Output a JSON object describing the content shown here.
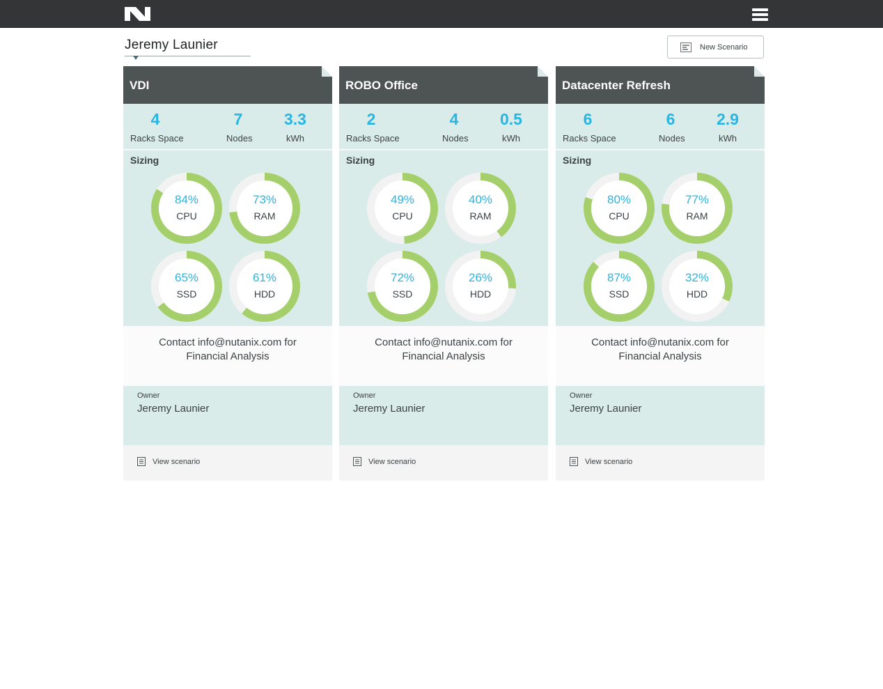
{
  "header": {
    "logo_icon": "nutanix-logo-icon",
    "menu_icon": "hamburger-menu-icon"
  },
  "toolbar": {
    "user_name": "Jeremy Launier",
    "new_scenario_label": "New Scenario",
    "new_scenario_icon": "scenario-form-icon"
  },
  "colors": {
    "accent_blue": "#27b5e3",
    "gauge_green": "#a5cf6a",
    "panel_teal": "#d9ecea",
    "header_dark": "#4e5354",
    "topbar": "#333537"
  },
  "cards": [
    {
      "title": "VDI",
      "stats": [
        {
          "value": "4",
          "label": "Racks Space"
        },
        {
          "value": "7",
          "label": "Nodes"
        },
        {
          "value": "3.3",
          "label": "kWh"
        }
      ],
      "sizing_title": "Sizing",
      "gauges": [
        {
          "percent": 84,
          "percent_text": "84%",
          "label": "CPU"
        },
        {
          "percent": 73,
          "percent_text": "73%",
          "label": "RAM"
        },
        {
          "percent": 65,
          "percent_text": "65%",
          "label": "SSD"
        },
        {
          "percent": 61,
          "percent_text": "61%",
          "label": "HDD"
        }
      ],
      "contact_text": "Contact info@nutanix.com for Financial Analysis",
      "owner_label": "Owner",
      "owner_name": "Jeremy Launier",
      "view_label": "View scenario"
    },
    {
      "title": "ROBO Office",
      "stats": [
        {
          "value": "2",
          "label": "Racks Space"
        },
        {
          "value": "4",
          "label": "Nodes"
        },
        {
          "value": "0.5",
          "label": "kWh"
        }
      ],
      "sizing_title": "Sizing",
      "gauges": [
        {
          "percent": 49,
          "percent_text": "49%",
          "label": "CPU"
        },
        {
          "percent": 40,
          "percent_text": "40%",
          "label": "RAM"
        },
        {
          "percent": 72,
          "percent_text": "72%",
          "label": "SSD"
        },
        {
          "percent": 26,
          "percent_text": "26%",
          "label": "HDD"
        }
      ],
      "contact_text": "Contact info@nutanix.com for Financial Analysis",
      "owner_label": "Owner",
      "owner_name": "Jeremy Launier",
      "view_label": "View scenario"
    },
    {
      "title": "Datacenter Refresh",
      "stats": [
        {
          "value": "6",
          "label": "Racks Space"
        },
        {
          "value": "6",
          "label": "Nodes"
        },
        {
          "value": "2.9",
          "label": "kWh"
        }
      ],
      "sizing_title": "Sizing",
      "gauges": [
        {
          "percent": 80,
          "percent_text": "80%",
          "label": "CPU"
        },
        {
          "percent": 77,
          "percent_text": "77%",
          "label": "RAM"
        },
        {
          "percent": 87,
          "percent_text": "87%",
          "label": "SSD"
        },
        {
          "percent": 32,
          "percent_text": "32%",
          "label": "HDD"
        }
      ],
      "contact_text": "Contact info@nutanix.com for Financial Analysis",
      "owner_label": "Owner",
      "owner_name": "Jeremy Launier",
      "view_label": "View scenario"
    }
  ]
}
